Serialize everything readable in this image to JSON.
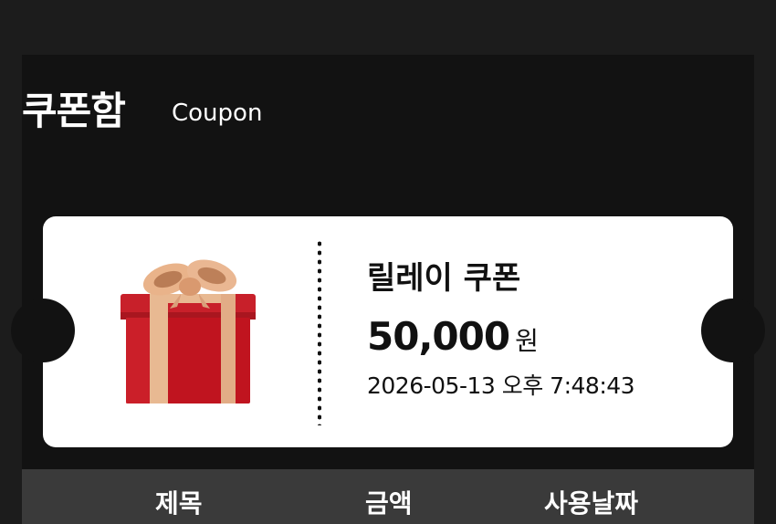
{
  "header": {
    "title": "쿠폰함",
    "subtitle": "Coupon"
  },
  "coupon": {
    "icon": "gift-icon",
    "name": "릴레이 쿠폰",
    "amount": "50,000",
    "unit": "원",
    "date": "2026-05-13 오후 7:48:43"
  },
  "table": {
    "columns": [
      "제목",
      "금액",
      "사용날짜"
    ]
  },
  "colors": {
    "background": "#1c1c1c",
    "panel": "#121212",
    "card": "#ffffff",
    "table_header": "#3a3a3a",
    "gift_red": "#c8202a",
    "ribbon_gold": "#e6b48c"
  }
}
